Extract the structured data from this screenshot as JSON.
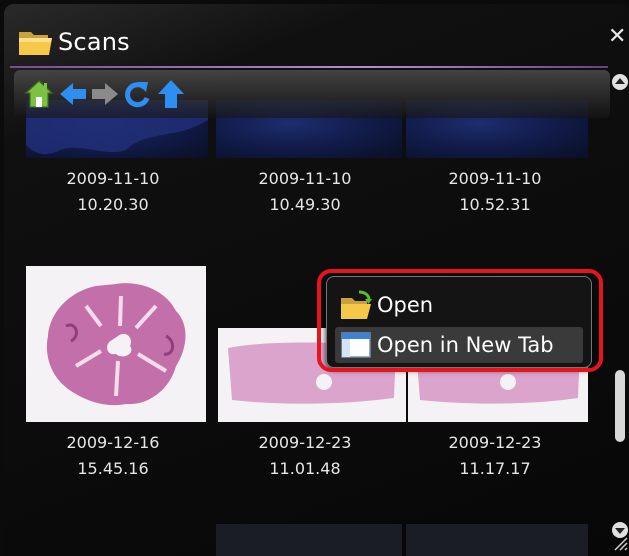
{
  "window": {
    "title": "Scans",
    "close_label": "✕"
  },
  "toolbar": {
    "buttons": [
      {
        "name": "home-icon",
        "enabled": true
      },
      {
        "name": "back-icon",
        "enabled": true
      },
      {
        "name": "forward-icon",
        "enabled": false
      },
      {
        "name": "refresh-icon",
        "enabled": true
      },
      {
        "name": "up-icon",
        "enabled": true
      }
    ]
  },
  "scans": [
    {
      "date": "2009-11-10",
      "time": "10.20.30",
      "thumb": "dark-blue"
    },
    {
      "date": "2009-11-10",
      "time": "10.49.30",
      "thumb": "dark-blue"
    },
    {
      "date": "2009-11-10",
      "time": "10.52.31",
      "thumb": "dark-blue"
    },
    {
      "date": "2009-12-16",
      "time": "15.45.16",
      "thumb": "tissue-round"
    },
    {
      "date": "2009-12-23",
      "time": "11.01.48",
      "thumb": "tissue-strip"
    },
    {
      "date": "2009-12-23",
      "time": "11.17.17",
      "thumb": "tissue-strip"
    }
  ],
  "context_menu": {
    "items": [
      {
        "label": "Open",
        "icon": "open-folder-icon"
      },
      {
        "label": "Open in New Tab",
        "icon": "new-tab-icon"
      }
    ],
    "highlight_color": "#e8141c"
  },
  "colors": {
    "accent_purple": "#b88bd6",
    "icon_blue": "#2f8ff0",
    "home_green": "#7cc242"
  }
}
